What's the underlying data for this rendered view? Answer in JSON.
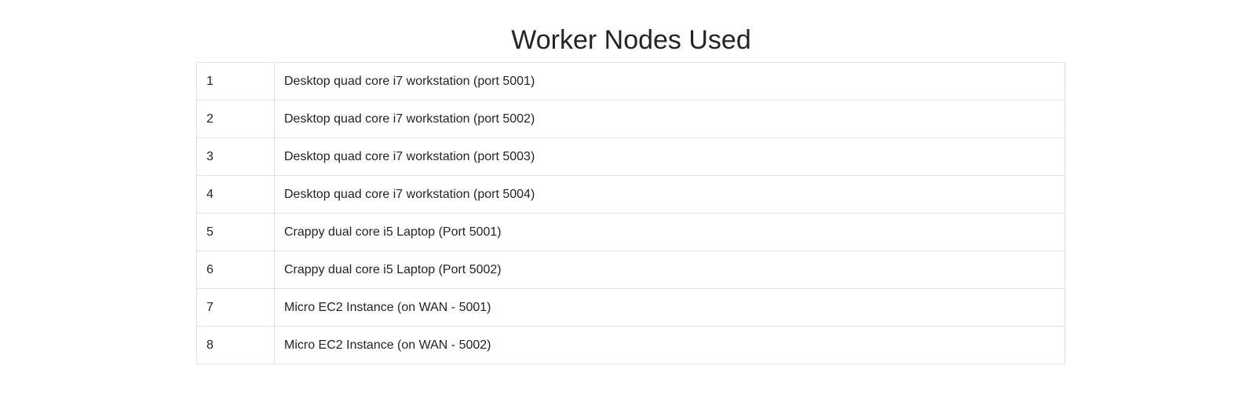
{
  "page": {
    "title": "Worker Nodes Used"
  },
  "nodes": [
    {
      "id": "1",
      "description": "Desktop quad core i7 workstation (port 5001)"
    },
    {
      "id": "2",
      "description": "Desktop quad core i7 workstation (port 5002)"
    },
    {
      "id": "3",
      "description": "Desktop quad core i7 workstation (port 5003)"
    },
    {
      "id": "4",
      "description": "Desktop quad core i7 workstation (port 5004)"
    },
    {
      "id": "5",
      "description": "Crappy dual core i5 Laptop (Port 5001)"
    },
    {
      "id": "6",
      "description": "Crappy dual core i5 Laptop (Port 5002)"
    },
    {
      "id": "7",
      "description": "Micro EC2 Instance (on WAN - 5001)"
    },
    {
      "id": "8",
      "description": "Micro EC2 Instance (on WAN - 5002)"
    }
  ]
}
